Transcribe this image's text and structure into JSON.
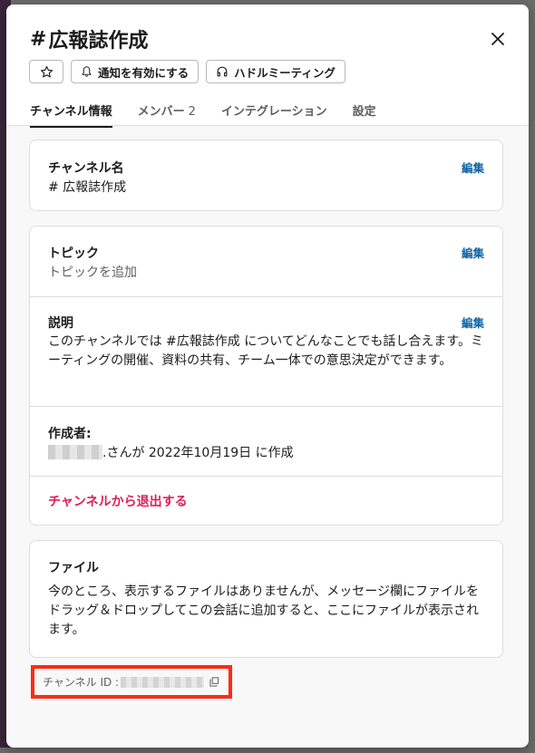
{
  "modal": {
    "title": "広報誌作成",
    "hash": "#",
    "actions": {
      "notify_label": "通知を有効にする",
      "huddle_label": "ハドルミーティング"
    },
    "tabs": [
      {
        "label": "チャンネル情報"
      },
      {
        "label": "メンバー",
        "count": "2"
      },
      {
        "label": "インテグレーション"
      },
      {
        "label": "設定"
      }
    ]
  },
  "channel_name": {
    "label": "チャンネル名",
    "value": "# 広報誌作成",
    "edit": "編集"
  },
  "topic": {
    "label": "トピック",
    "value": "トピックを追加",
    "edit": "編集"
  },
  "description": {
    "label": "説明",
    "value": "このチャンネルでは #広報誌作成 についてどんなことでも話し合えます。ミーティングの開催、資料の共有、チーム一体での意思決定ができます。",
    "edit": "編集"
  },
  "creator": {
    "label": "作成者:",
    "suffix": ".さんが 2022年10月19日 に作成"
  },
  "leave": {
    "label": "チャンネルから退出する"
  },
  "files": {
    "label": "ファイル",
    "text": "今のところ、表示するファイルはありませんが、メッセージ欄にファイルをドラッグ＆ドロップしてこの会話に追加すると、ここにファイルが表示されます。"
  },
  "channel_id": {
    "label": "チャンネル ID :"
  },
  "colors": {
    "link": "#1264a3",
    "danger": "#e01e5a",
    "highlight": "#ff2a14"
  }
}
